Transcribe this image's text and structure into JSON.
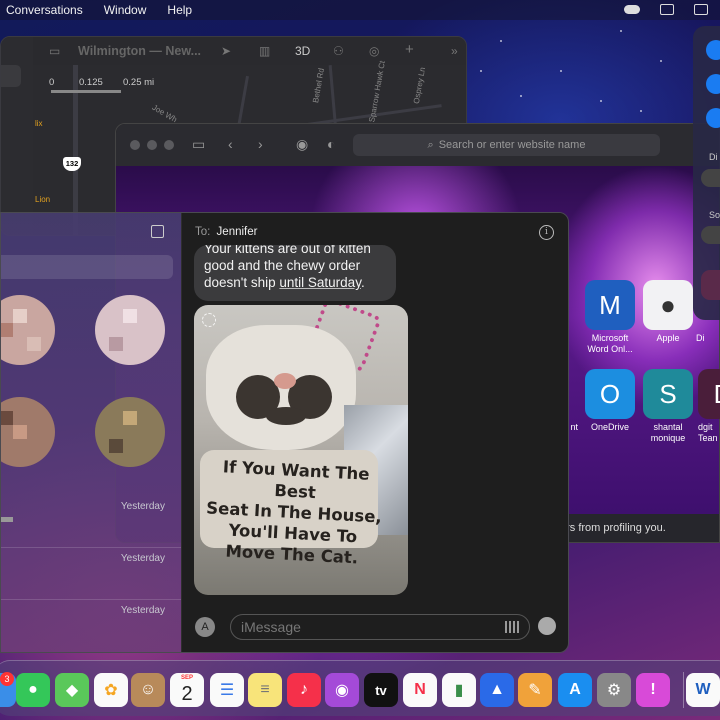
{
  "menubar": {
    "items": [
      "Conversations",
      "Window",
      "Help"
    ]
  },
  "maps": {
    "title": "Wilmington — New...",
    "mode_3d": "3D",
    "scale": {
      "zero": "0",
      "mid": "0.125",
      "end": "0.25 mi"
    },
    "road_labels": [
      "Bethel Rd",
      "Sparrow Hawk Ct",
      "Osprey Ln",
      "Joe Wh"
    ],
    "route_number": "132",
    "poi_labels": [
      "lix",
      "Lion"
    ]
  },
  "safari": {
    "address_placeholder": "Search or enter website name",
    "panel_text": "ers from profiling you.",
    "favorites": [
      {
        "label": "Microsoft Word Onl...",
        "glyph": "M",
        "color": "#1f5fbf"
      },
      {
        "label": "Apple",
        "glyph": "",
        "color": "#f2f2f4"
      },
      {
        "label": "Di",
        "glyph": "",
        "color": "#2a2a2e"
      },
      {
        "label": "nt",
        "glyph": "",
        "color": "#2a2a2e"
      },
      {
        "label": "OneDrive",
        "glyph": "O",
        "color": "#1c8ee0"
      },
      {
        "label": "shantal monique",
        "glyph": "S",
        "color": "#1f8a9a"
      },
      {
        "label": "dgit Tean",
        "glyph": "D",
        "color": "#4a1e3a"
      }
    ]
  },
  "control_center": {
    "labels": [
      "Di",
      "So"
    ]
  },
  "messages": {
    "conversation_times": [
      "Yesterday",
      "Yesterday",
      "Yesterday"
    ],
    "to_label": "To:",
    "recipient": "Jennifer",
    "bubble": {
      "line1": "Your kittens are out of kitten",
      "line2": "good and the chewy order",
      "line3_prefix": "doesn't ship ",
      "line3_underlined": "until Saturday",
      "line3_suffix": "."
    },
    "photo_sign": {
      "line1": "If You Want The Best",
      "line2": "Seat In The House,",
      "line3": "You'll Have To",
      "line4": "Move The Cat."
    },
    "input_placeholder": "iMessage"
  },
  "dock": {
    "messages_badge": "3",
    "calendar_month": "SEP",
    "calendar_day": "2",
    "tv_label": "tv",
    "word_label": "W"
  }
}
